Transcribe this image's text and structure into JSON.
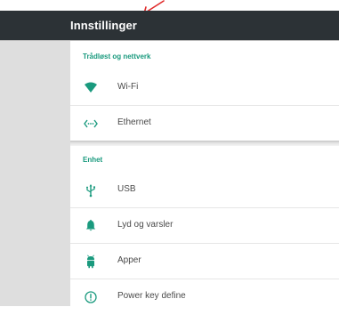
{
  "app_bar": {
    "title": "Innstillinger"
  },
  "sections": [
    {
      "header": "Trådløst og nettverk",
      "items": [
        {
          "label": "Wi-Fi",
          "icon": "wifi-icon"
        },
        {
          "label": "Ethernet",
          "icon": "ethernet-icon"
        }
      ]
    },
    {
      "header": "Enhet",
      "items": [
        {
          "label": "USB",
          "icon": "usb-icon"
        },
        {
          "label": "Lyd og varsler",
          "icon": "bell-icon"
        },
        {
          "label": "Apper",
          "icon": "android-icon"
        },
        {
          "label": "Power key define",
          "icon": "info-icon"
        }
      ]
    }
  ],
  "colors": {
    "app_bar": "#2c3236",
    "accent": "#1a9a7e",
    "annotation": "#e02a2a",
    "gutter": "#dedede"
  }
}
